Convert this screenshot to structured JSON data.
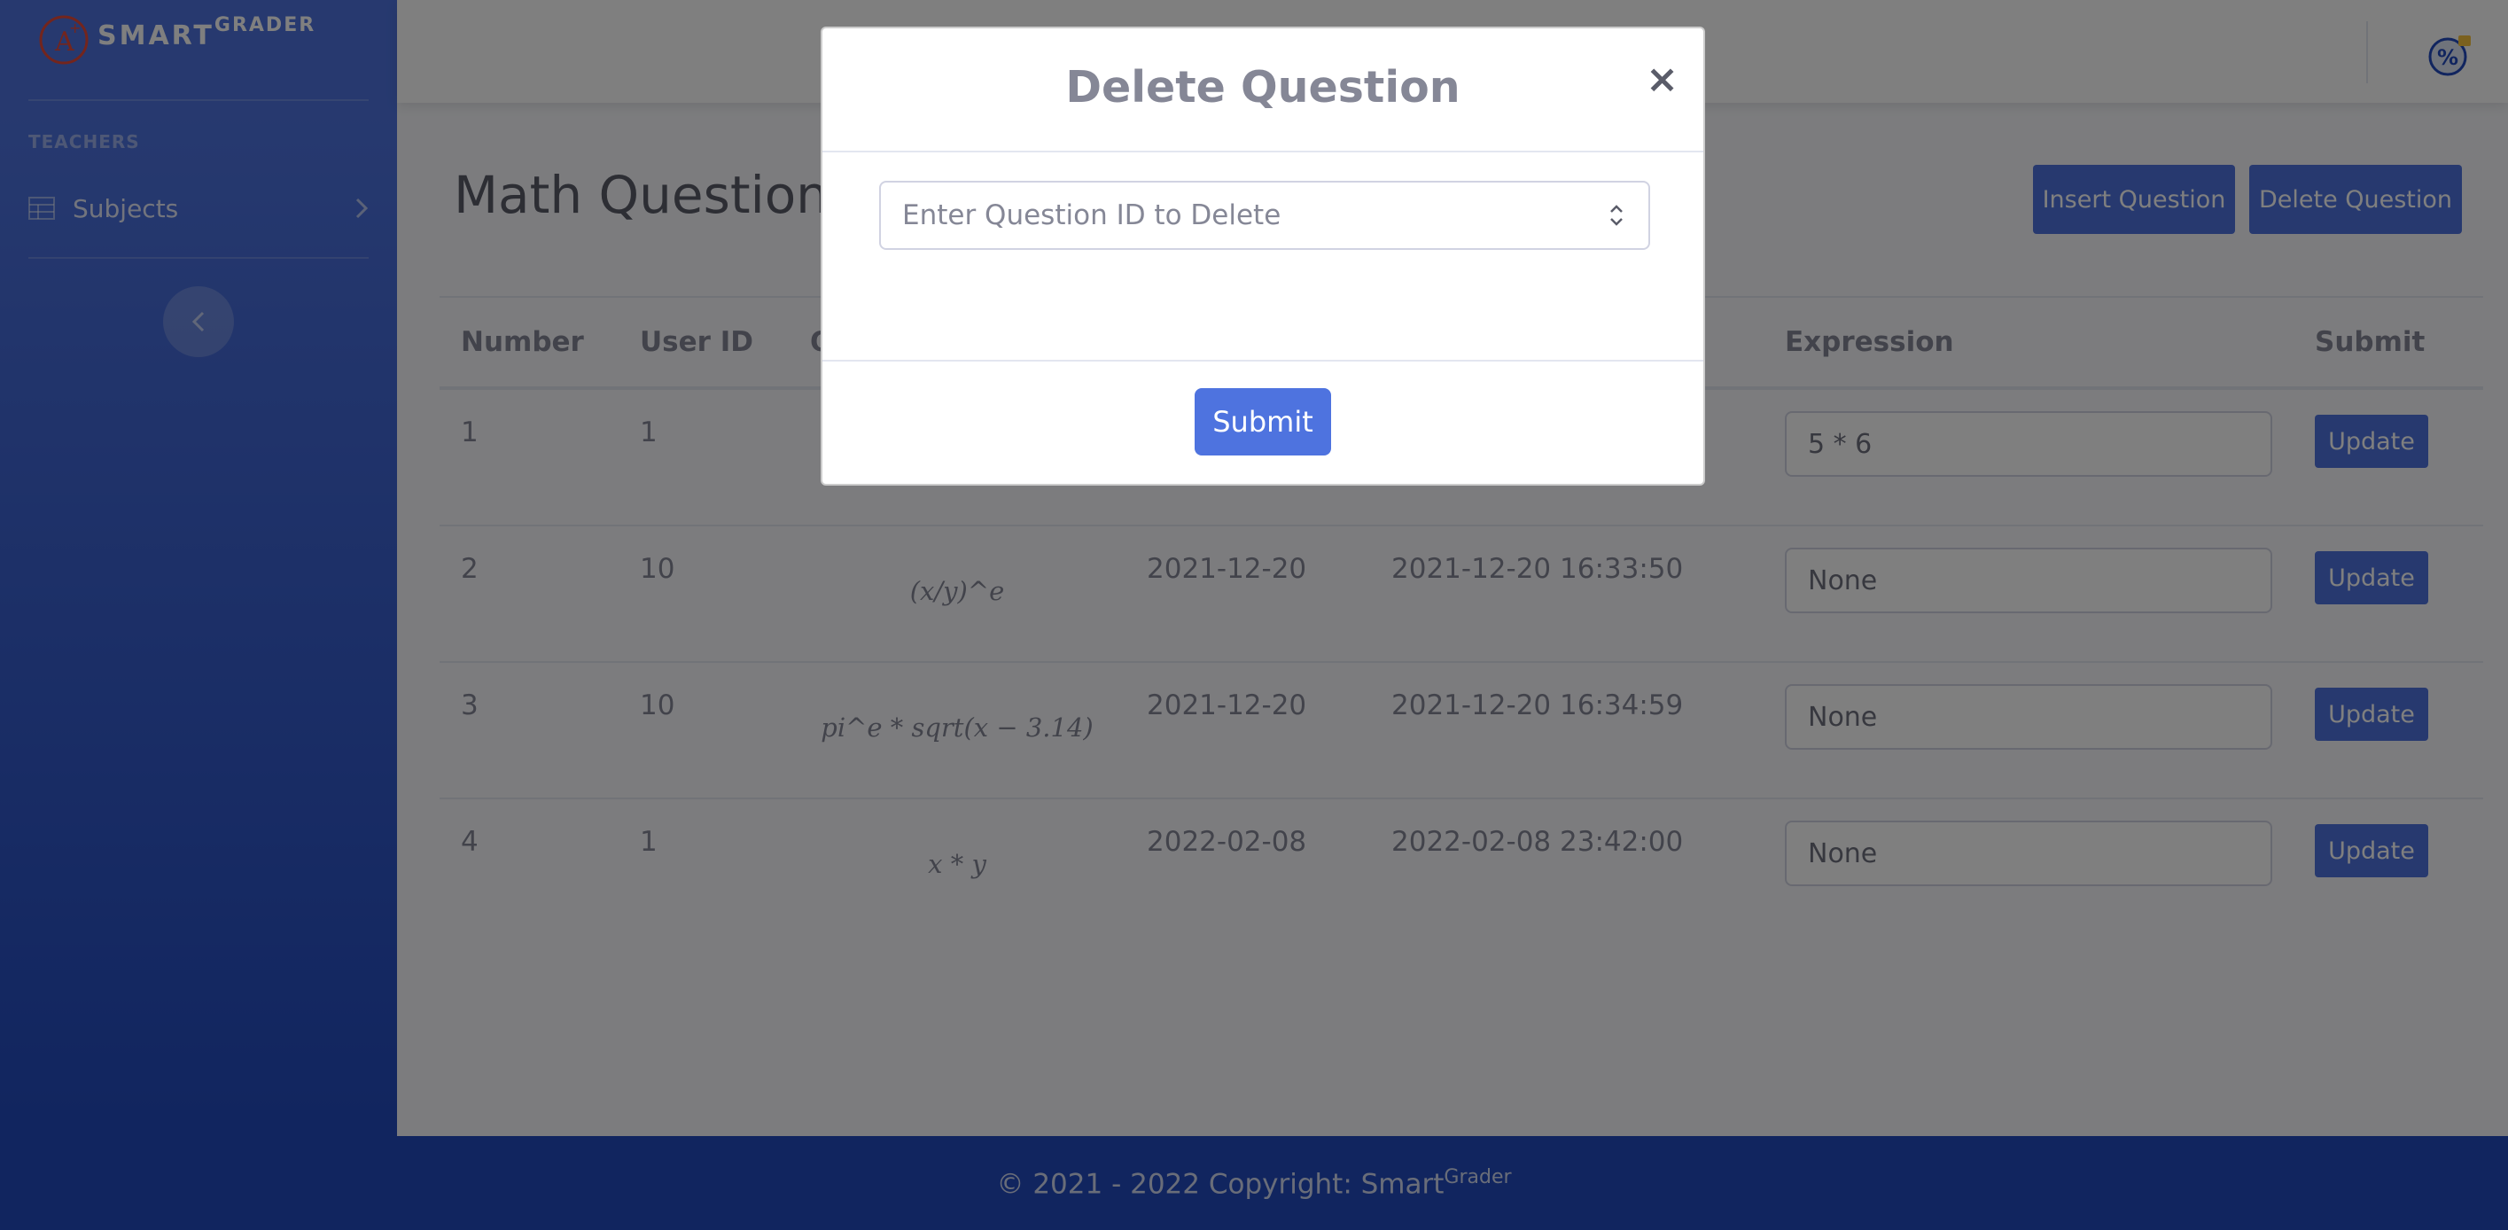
{
  "brand": {
    "name": "SMART",
    "name_sup": "GRADER"
  },
  "sidebar": {
    "heading": "TEACHERS",
    "items": [
      {
        "label": "Subjects"
      }
    ]
  },
  "page": {
    "title": "Math Questions",
    "insert_button": "Insert Question",
    "delete_button": "Delete Question"
  },
  "table": {
    "headers": [
      "Number",
      "User ID",
      "Q",
      "Expression",
      "Submit"
    ],
    "rows": [
      {
        "number": "1",
        "user_id": "1",
        "question": "",
        "date": "",
        "datetime": "",
        "expression": "5 * 6",
        "button": "Update"
      },
      {
        "number": "2",
        "user_id": "10",
        "question": "(x/y)^e",
        "date": "2021-12-20",
        "datetime": "2021-12-20 16:33:50",
        "expression": "None",
        "button": "Update"
      },
      {
        "number": "3",
        "user_id": "10",
        "question": "pi^e * sqrt(x − 3.14)",
        "date": "2021-12-20",
        "datetime": "2021-12-20 16:34:59",
        "expression": "None",
        "button": "Update"
      },
      {
        "number": "4",
        "user_id": "1",
        "question": "x * y",
        "date": "2022-02-08",
        "datetime": "2022-02-08 23:42:00",
        "expression": "None",
        "button": "Update"
      }
    ]
  },
  "modal": {
    "title": "Delete Question",
    "close": "×",
    "input_placeholder": "Enter Question ID to Delete",
    "submit": "Submit"
  },
  "footer": {
    "text": "© 2021 - 2022 Copyright: Smart",
    "sup": "Grader"
  },
  "colors": {
    "primary": "#4e73df",
    "sidebar_dark": "#224abe",
    "text": "#858796"
  }
}
